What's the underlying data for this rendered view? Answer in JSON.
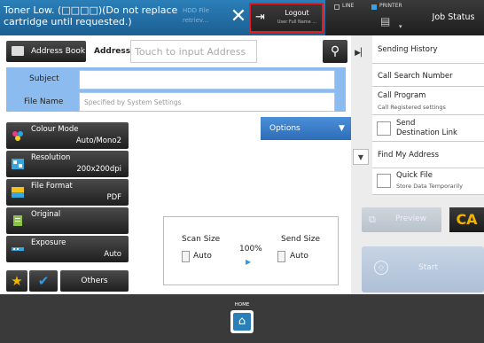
{
  "topbar": {
    "toner_message": "Toner Low. (□□□□)(Do not replace cartridge until requested.)",
    "hdd_label": "HDD File retriev...",
    "logout_label": "Logout",
    "user_name": "User Full Name ...",
    "line_label": "LINE",
    "printer_label": "PRINTER",
    "job_status_label": "Job Status",
    "printer_indicator_color": "#3aa0e0",
    "logout_highlight_color": "#e21d24"
  },
  "address": {
    "address_book_label": "Address Book",
    "address_label": "Address",
    "address_placeholder": "Touch to input Address"
  },
  "fields": {
    "subject_label": "Subject",
    "file_name_label": "File Name",
    "file_name_placeholder": "Specified by System Settings"
  },
  "settings": [
    {
      "title": "Colour Mode",
      "value": "Auto/Mono2",
      "icon": "colour-mode-icon"
    },
    {
      "title": "Resolution",
      "value": "200x200dpi",
      "icon": "resolution-icon"
    },
    {
      "title": "File Format",
      "value": "PDF",
      "icon": "file-format-icon"
    },
    {
      "title": "Original",
      "value": "",
      "icon": "original-icon"
    },
    {
      "title": "Exposure",
      "value": "Auto",
      "icon": "exposure-icon"
    }
  ],
  "options_label": "Options",
  "size": {
    "scan_size_label": "Scan Size",
    "send_size_label": "Send Size",
    "scan_value": "Auto",
    "send_value": "Auto",
    "ratio": "100%"
  },
  "bottom_buttons": {
    "others_label": "Others"
  },
  "right_menu": {
    "sending_history": "Sending History",
    "call_search_number": "Call Search Number",
    "call_program": "Call Program",
    "call_registered": "Call Registered settings",
    "send_destination_link": "Send Destination Link",
    "find_my_address": "Find My Address",
    "quick_file": "Quick File",
    "store_data": "Store Data Temporarily"
  },
  "actions": {
    "preview_label": "Preview",
    "ca_label": "CA",
    "start_label": "Start"
  },
  "home_label": "HOME"
}
